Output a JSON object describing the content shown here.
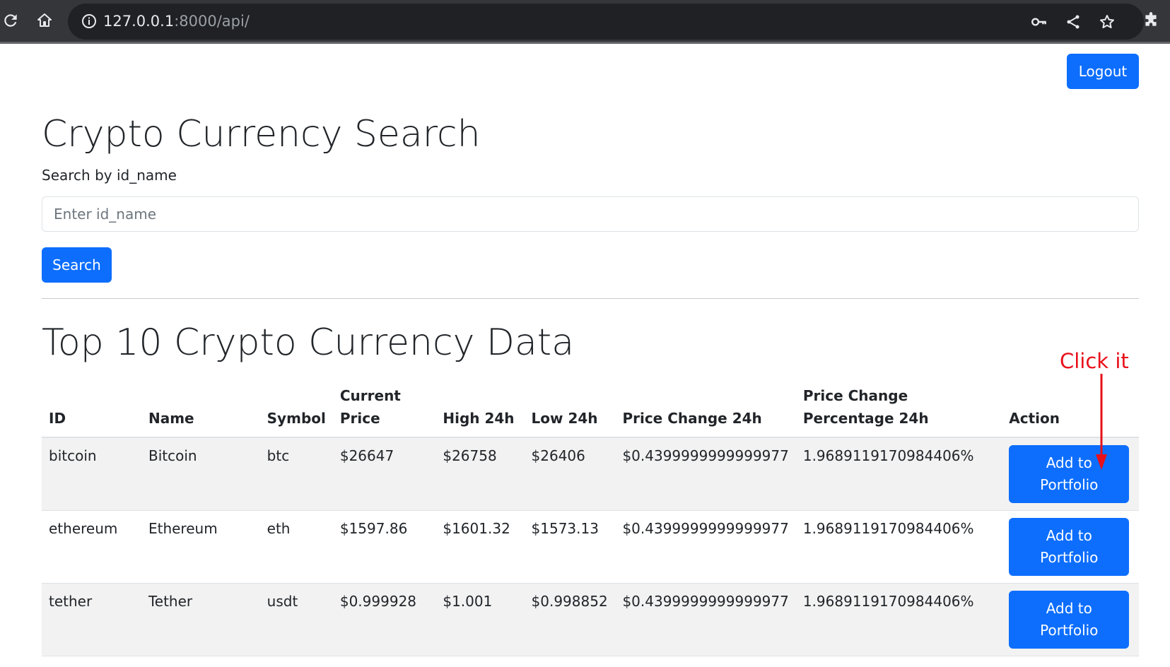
{
  "browser": {
    "url_host": "127.0.0.1",
    "url_rest": ":8000/api/",
    "icons": [
      "reload-icon",
      "home-icon",
      "info-icon",
      "key-icon",
      "share-icon",
      "star-icon",
      "extensions-icon"
    ]
  },
  "header": {
    "logout_label": "Logout"
  },
  "search": {
    "title": "Crypto Currency Search",
    "label": "Search by id_name",
    "placeholder": "Enter id_name",
    "button_label": "Search"
  },
  "table_section": {
    "title": "Top 10 Crypto Currency Data",
    "columns": [
      "ID",
      "Name",
      "Symbol",
      "Current Price",
      "High 24h",
      "Low 24h",
      "Price Change 24h",
      "Price Change Percentage 24h",
      "Action"
    ],
    "rows": [
      {
        "id": "bitcoin",
        "name": "Bitcoin",
        "symbol": "btc",
        "current_price": "$26647",
        "high_24h": "$26758",
        "low_24h": "$26406",
        "price_change_24h": "$0.4399999999999977",
        "price_change_pct_24h": "1.9689119170984406%",
        "action": "Add to Portfolio"
      },
      {
        "id": "ethereum",
        "name": "Ethereum",
        "symbol": "eth",
        "current_price": "$1597.86",
        "high_24h": "$1601.32",
        "low_24h": "$1573.13",
        "price_change_24h": "$0.4399999999999977",
        "price_change_pct_24h": "1.9689119170984406%",
        "action": "Add to Portfolio"
      },
      {
        "id": "tether",
        "name": "Tether",
        "symbol": "usdt",
        "current_price": "$0.999928",
        "high_24h": "$1.001",
        "low_24h": "$0.998852",
        "price_change_24h": "$0.4399999999999977",
        "price_change_pct_24h": "1.9689119170984406%",
        "action": "Add to Portfolio"
      }
    ]
  },
  "annotation": {
    "text": "Click it",
    "color": "#e8101a"
  },
  "colors": {
    "primary": "#0d6efd",
    "stripe": "#f2f2f2",
    "chrome": "#35363a",
    "omnibox": "#202124"
  }
}
